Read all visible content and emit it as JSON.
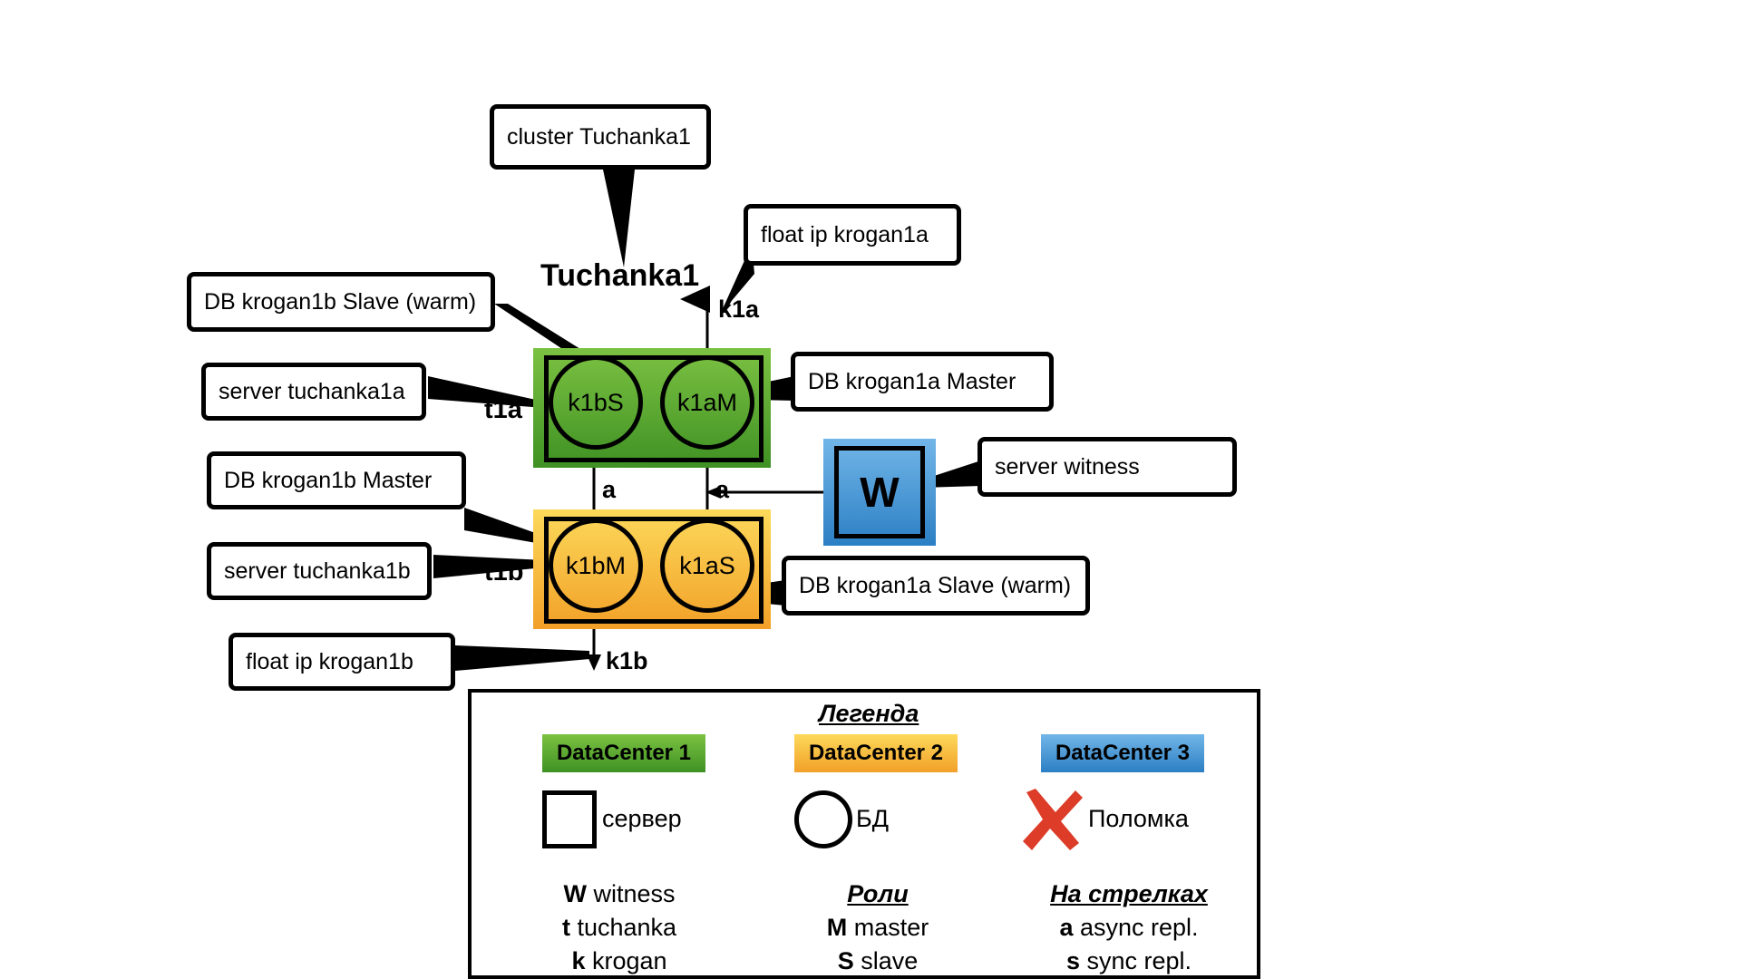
{
  "diagram": {
    "cluster_label": "Tuchanka1",
    "callouts": {
      "cluster": "cluster Tuchanka1",
      "float_ip_a": "float ip krogan1a",
      "float_ip_b": "float ip krogan1b",
      "db_krogan1b_slave": "DB krogan1b Slave (warm)",
      "db_krogan1b_master": "DB krogan1b Master",
      "db_krogan1a_master": "DB krogan1a Master",
      "db_krogan1a_slave": "DB krogan1a Slave (warm)",
      "server_tuchanka1a": "server tuchanka1a",
      "server_tuchanka1b": "server tuchanka1b",
      "server_witness": "server witness"
    },
    "nodes": {
      "server_a_label": "t1a",
      "server_b_label": "t1b",
      "witness_label": "W",
      "db_k1bS": "k1bS",
      "db_k1aM": "k1aM",
      "db_k1bM": "k1bM",
      "db_k1aS": "k1aS"
    },
    "arrows": {
      "float_ip_a_label": "k1a",
      "float_ip_b_label": "k1b",
      "repl_left": "a",
      "repl_right": "a"
    },
    "colors": {
      "datacenter1": "#4a9c26",
      "datacenter2": "#f5b335",
      "datacenter3": "#3f91d2",
      "failure": "#dc3c28",
      "stroke": "#000000",
      "background": "#ffffff"
    }
  },
  "legend": {
    "title": "Легенда",
    "datacenters": [
      {
        "label": "DataCenter 1",
        "color": "#4a9c26"
      },
      {
        "label": "DataCenter 2",
        "color": "#f5b335"
      },
      {
        "label": "DataCenter 3",
        "color": "#3f91d2"
      }
    ],
    "symbols": [
      {
        "icon": "square-icon",
        "label": "сервер"
      },
      {
        "icon": "circle-icon",
        "label": "БД"
      },
      {
        "icon": "cross-icon",
        "label": "Поломка"
      }
    ],
    "columns": [
      {
        "header": "",
        "rows": [
          {
            "key": "W",
            "text": "witness"
          },
          {
            "key": "t",
            "text": "tuchanka"
          },
          {
            "key": "k",
            "text": "krogan"
          }
        ]
      },
      {
        "header": "Роли",
        "rows": [
          {
            "key": "M",
            "text": "master"
          },
          {
            "key": "S",
            "text": "slave"
          }
        ]
      },
      {
        "header": "На стрелках",
        "rows": [
          {
            "key": "a",
            "text": "async repl."
          },
          {
            "key": "s",
            "text": "sync repl."
          }
        ]
      }
    ]
  }
}
